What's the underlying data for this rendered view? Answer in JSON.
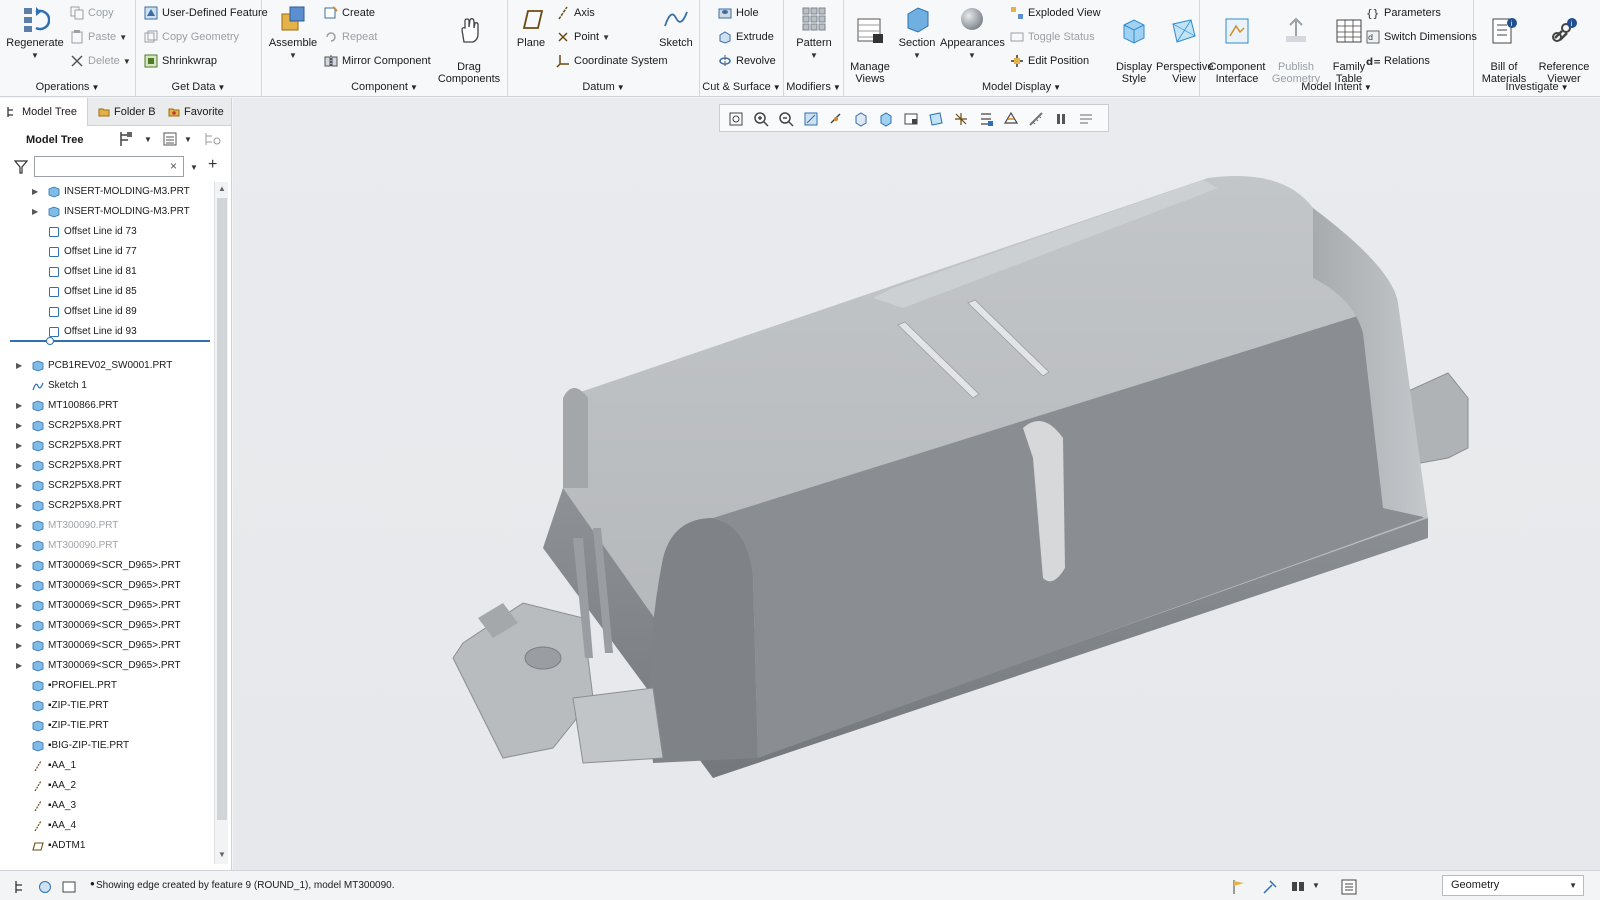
{
  "ribbon": {
    "operations": {
      "label": "Operations",
      "regenerate": "Regenerate",
      "copy": "Copy",
      "paste": "Paste",
      "delete": "Delete"
    },
    "get_data": {
      "label": "Get Data",
      "udf": "User-Defined Feature",
      "copy_geometry": "Copy Geometry",
      "shrinkwrap": "Shrinkwrap"
    },
    "component": {
      "label": "Component",
      "assemble": "Assemble",
      "create": "Create",
      "repeat": "Repeat",
      "mirror": "Mirror Component",
      "drag": "Drag\nComponents"
    },
    "datum": {
      "label": "Datum",
      "plane": "Plane",
      "axis": "Axis",
      "point": "Point",
      "csys": "Coordinate System",
      "sketch": "Sketch"
    },
    "cut_surface": {
      "label": "Cut & Surface",
      "hole": "Hole",
      "extrude": "Extrude",
      "revolve": "Revolve"
    },
    "modifiers": {
      "label": "Modifiers",
      "pattern": "Pattern"
    },
    "model_display": {
      "label": "Model Display",
      "manage_views": "Manage\nViews",
      "section": "Section",
      "appearances": "Appearances",
      "exploded_view": "Exploded View",
      "toggle_status": "Toggle Status",
      "edit_position": "Edit Position",
      "display_style": "Display\nStyle",
      "perspective_view": "Perspective\nView"
    },
    "model_intent": {
      "label": "Model Intent",
      "component_interface": "Component\nInterface",
      "publish_geometry": "Publish\nGeometry",
      "family_table": "Family\nTable",
      "parameters": "Parameters",
      "switch_dimensions": "Switch Dimensions",
      "relations": "Relations"
    },
    "investigate": {
      "label": "Investigate",
      "bom": "Bill of\nMaterials",
      "reference_viewer": "Reference\nViewer"
    }
  },
  "panel": {
    "tabs": [
      "Model Tree",
      "Folder B",
      "Favorite"
    ],
    "title": "Model Tree",
    "search_placeholder": ""
  },
  "tree": [
    {
      "label": "INSERT-MOLDING-M3.PRT",
      "indent": 1,
      "exp": true,
      "icon": "part",
      "dim": false
    },
    {
      "label": "INSERT-MOLDING-M3.PRT",
      "indent": 1,
      "exp": true,
      "icon": "part",
      "dim": false
    },
    {
      "label": "Offset Line id 73",
      "indent": 1,
      "exp": false,
      "icon": "feature",
      "dim": false
    },
    {
      "label": "Offset Line id 77",
      "indent": 1,
      "exp": false,
      "icon": "feature",
      "dim": false
    },
    {
      "label": "Offset Line id 81",
      "indent": 1,
      "exp": false,
      "icon": "feature",
      "dim": false
    },
    {
      "label": "Offset Line id 85",
      "indent": 1,
      "exp": false,
      "icon": "feature",
      "dim": false
    },
    {
      "label": "Offset Line id 89",
      "indent": 1,
      "exp": false,
      "icon": "feature",
      "dim": false
    },
    {
      "label": "Offset Line id 93",
      "indent": 1,
      "exp": false,
      "icon": "feature",
      "dim": false
    },
    {
      "label": "PCB1REV02_SW0001.PRT",
      "indent": 0,
      "exp": true,
      "icon": "part",
      "dim": false
    },
    {
      "label": "Sketch 1",
      "indent": 0,
      "exp": false,
      "icon": "sketch",
      "dim": false
    },
    {
      "label": "MT100866.PRT",
      "indent": 0,
      "exp": true,
      "icon": "part",
      "dim": false
    },
    {
      "label": "SCR2P5X8.PRT",
      "indent": 0,
      "exp": true,
      "icon": "part",
      "dim": false
    },
    {
      "label": "SCR2P5X8.PRT",
      "indent": 0,
      "exp": true,
      "icon": "part",
      "dim": false
    },
    {
      "label": "SCR2P5X8.PRT",
      "indent": 0,
      "exp": true,
      "icon": "part",
      "dim": false
    },
    {
      "label": "SCR2P5X8.PRT",
      "indent": 0,
      "exp": true,
      "icon": "part",
      "dim": false
    },
    {
      "label": "SCR2P5X8.PRT",
      "indent": 0,
      "exp": true,
      "icon": "part",
      "dim": false
    },
    {
      "label": "MT300090.PRT",
      "indent": 0,
      "exp": true,
      "icon": "part",
      "dim": true
    },
    {
      "label": "MT300090.PRT",
      "indent": 0,
      "exp": true,
      "icon": "part",
      "dim": true
    },
    {
      "label": "MT300069<SCR_D965>.PRT",
      "indent": 0,
      "exp": true,
      "icon": "part",
      "dim": false
    },
    {
      "label": "MT300069<SCR_D965>.PRT",
      "indent": 0,
      "exp": true,
      "icon": "part",
      "dim": false
    },
    {
      "label": "MT300069<SCR_D965>.PRT",
      "indent": 0,
      "exp": true,
      "icon": "part",
      "dim": false
    },
    {
      "label": "MT300069<SCR_D965>.PRT",
      "indent": 0,
      "exp": true,
      "icon": "part",
      "dim": false
    },
    {
      "label": "MT300069<SCR_D965>.PRT",
      "indent": 0,
      "exp": true,
      "icon": "part",
      "dim": false
    },
    {
      "label": "MT300069<SCR_D965>.PRT",
      "indent": 0,
      "exp": true,
      "icon": "part",
      "dim": false
    },
    {
      "label": "▪PROFIEL.PRT",
      "indent": 0,
      "exp": false,
      "icon": "part",
      "dim": false
    },
    {
      "label": "▪ZIP-TIE.PRT",
      "indent": 0,
      "exp": false,
      "icon": "part",
      "dim": false
    },
    {
      "label": "▪ZIP-TIE.PRT",
      "indent": 0,
      "exp": false,
      "icon": "part",
      "dim": false
    },
    {
      "label": "▪BIG-ZIP-TIE.PRT",
      "indent": 0,
      "exp": false,
      "icon": "part",
      "dim": false
    },
    {
      "label": "▪AA_1",
      "indent": 0,
      "exp": false,
      "icon": "axis",
      "dim": false
    },
    {
      "label": "▪AA_2",
      "indent": 0,
      "exp": false,
      "icon": "axis",
      "dim": false
    },
    {
      "label": "▪AA_3",
      "indent": 0,
      "exp": false,
      "icon": "axis",
      "dim": false
    },
    {
      "label": "▪AA_4",
      "indent": 0,
      "exp": false,
      "icon": "axis",
      "dim": false
    },
    {
      "label": "▪ADTM1",
      "indent": 0,
      "exp": false,
      "icon": "plane",
      "dim": false
    }
  ],
  "status": {
    "message": "Showing edge created by feature 9 (ROUND_1), model MT300090.",
    "selector": "Geometry"
  }
}
